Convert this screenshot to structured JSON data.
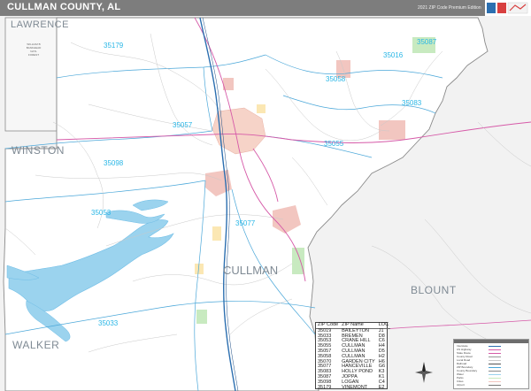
{
  "header": {
    "title": "CULLMAN COUNTY, AL",
    "edition": "2021 ZIP Code Premium Edition",
    "logo_icon": "map-publisher-logo-icon"
  },
  "colors": {
    "header_bg": "#7d7d7d",
    "outside_bg": "#f4f4f4",
    "county_bg": "#ffffff",
    "zip_label": "#29b6e6",
    "water": "#9bd3ee",
    "city_fill": "#f6c6c6",
    "park_fill": "#c8eac0",
    "interstate": "#2c6fb0",
    "highway": "#d65aa8",
    "border": "#8a8a8a"
  },
  "county_labels": {
    "lawrence": "LAWRENCE",
    "winston": "WINSTON",
    "walker": "WALKER",
    "blount": "BLOUNT",
    "cullman": "CULLMAN"
  },
  "zip_labels": {
    "z35179": "35179",
    "z35087": "35087",
    "z35016": "35016",
    "z35058": "35058",
    "z35083": "35083",
    "z35057": "35057",
    "z35055": "35055",
    "z35098": "35098",
    "z35053": "35053",
    "z35077": "35077",
    "z35033": "35033"
  },
  "map_text": {
    "minor_place": "WILLIAM B BANKHEAD NATL FOREST"
  },
  "zip_table": {
    "headers": [
      "ZIP Code",
      "ZIP Name",
      "LOC"
    ],
    "rows": [
      [
        "35019",
        "BAILEYTON",
        "J1"
      ],
      [
        "35033",
        "BREMEN",
        "D8"
      ],
      [
        "35053",
        "CRANE HILL",
        "C6"
      ],
      [
        "35055",
        "CULLMAN",
        "H4"
      ],
      [
        "35057",
        "CULLMAN",
        "D5"
      ],
      [
        "35058",
        "CULLMAN",
        "H2"
      ],
      [
        "35070",
        "GARDEN CITY",
        "H6"
      ],
      [
        "35077",
        "HANCEVILLE",
        "G6"
      ],
      [
        "35083",
        "HOLLY POND",
        "K3"
      ],
      [
        "35087",
        "JOPPA",
        "K1"
      ],
      [
        "35098",
        "LOGAN",
        "C4"
      ],
      [
        "35179",
        "VINEMONT",
        "E2"
      ]
    ]
  },
  "legend": {
    "rows": [
      "Interstate",
      "US Highway",
      "State Route",
      "County Road",
      "Local Road",
      "Railroad",
      "ZIP Boundary",
      "County Boundary",
      "Water",
      "Parks",
      "Cities",
      "Airport"
    ]
  },
  "compass_icon": "compass-rose-icon"
}
